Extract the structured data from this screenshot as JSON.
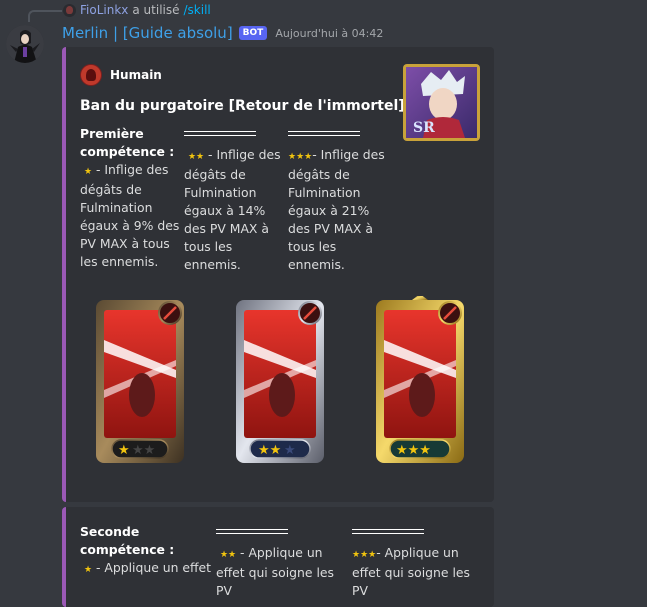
{
  "reply": {
    "user": "FioLinkx",
    "text": "a utilisé",
    "command": "/skill"
  },
  "message": {
    "author": "Merlin | [Guide absolu]",
    "badge": "BOT",
    "timestamp": "Aujourd'hui à 04:42"
  },
  "embed1": {
    "author": "Humain",
    "title": "Ban du purgatoire [Retour de l'immortel]",
    "field1": {
      "name_line1": "Première",
      "name_line2": "compétence :",
      "stars": "★",
      "value": " - Inflige des dégâts de Fulmination égaux à 9% des PV MAX à tous les ennemis."
    },
    "field2": {
      "stars": "★★",
      "value": " - Inflige des dégâts de Fulmination égaux à 14% des PV MAX à tous les ennemis."
    },
    "field3": {
      "stars": "★★★",
      "value": "- Inflige des dégâts de Fulmination égaux à 21% des PV MAX à tous les ennemis."
    },
    "cards": [
      "bronze",
      "silver",
      "gold"
    ]
  },
  "embed2": {
    "field1": {
      "name_line1": "Seconde",
      "name_line2": "compétence :",
      "stars": "★",
      "value": " - Applique un effet"
    },
    "field2": {
      "stars": "★★",
      "value": " - Applique un effet qui soigne les PV"
    },
    "field3": {
      "stars": "★★★",
      "value": "- Applique un effet qui soigne les PV"
    }
  },
  "colors": {
    "embed_border": "#9b59b6",
    "author": "#3ea0e8",
    "badge": "#5865f2",
    "command": "#00aff4"
  }
}
